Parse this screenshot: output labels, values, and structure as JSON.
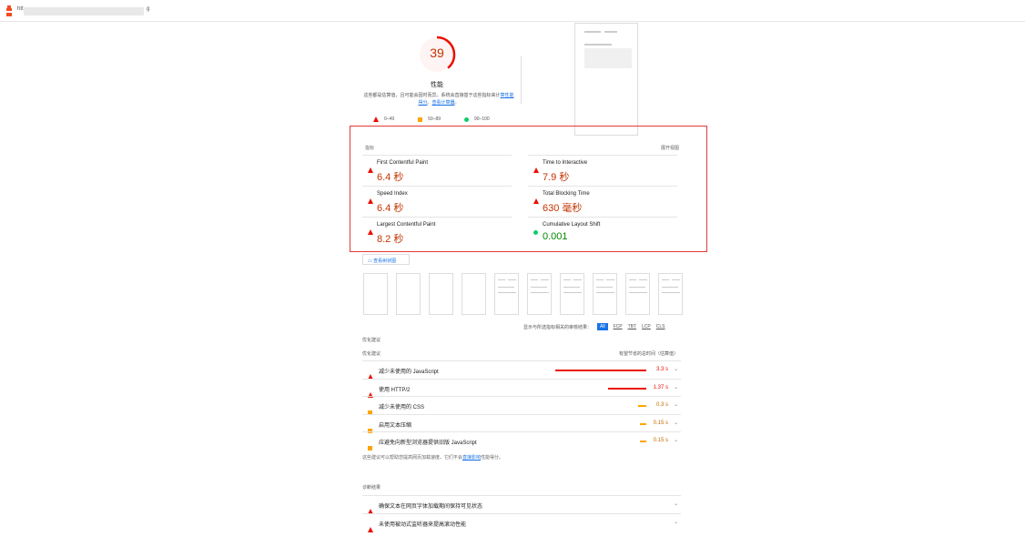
{
  "browser": {
    "url_start": "htt",
    "url_end": "g"
  },
  "score": {
    "value": "39",
    "fraction": 0.39,
    "title": "性能",
    "description": "这些都是估算值，且可能会因时而异。系统会直接基于这些指标来计",
    "link1": "算性能得分",
    "link2": "查看计算器"
  },
  "legend": {
    "fail": "0–49",
    "average": "50–89",
    "pass": "90–100"
  },
  "metrics": {
    "header": "指标",
    "expand": "展开视图",
    "items": [
      {
        "label": "First Contentful Paint",
        "value": "6.4 秒",
        "status": "fail"
      },
      {
        "label": "Time to Interactive",
        "value": "7.9 秒",
        "status": "fail"
      },
      {
        "label": "Speed Index",
        "value": "6.4 秒",
        "status": "fail"
      },
      {
        "label": "Total Blocking Time",
        "value": "630 毫秒",
        "status": "fail"
      },
      {
        "label": "Largest Contentful Paint",
        "value": "8.2 秒",
        "status": "fail"
      },
      {
        "label": "Cumulative Layout Shift",
        "value": "0.001",
        "status": "pass"
      }
    ]
  },
  "treemap": {
    "label": "查看树状图"
  },
  "filter": {
    "label": "显示与所选指标相关的审核结果：",
    "options": [
      "All",
      "FCP",
      "TBT",
      "LCP",
      "CLS"
    ]
  },
  "opportunities": {
    "section_title": "优化建议",
    "col_left": "优化建议",
    "col_right": "有望节省的总时间（估算值）",
    "items": [
      {
        "label": "减少未使用的 JavaScript",
        "savings": "3.3 s",
        "fraction": 1.0,
        "status": "fail"
      },
      {
        "label": "使用 HTTP/2",
        "savings": "1.37 s",
        "fraction": 0.42,
        "status": "fail"
      },
      {
        "label": "减少未使用的 CSS",
        "savings": "0.3 s",
        "fraction": 0.09,
        "status": "average"
      },
      {
        "label": "启用文本压缩",
        "savings": "0.15 s",
        "fraction": 0.045,
        "status": "average"
      },
      {
        "label": "应避免向新型浏览器提供旧版 JavaScript",
        "savings": "0.15 s",
        "fraction": 0.045,
        "status": "average"
      }
    ],
    "note_start": "这些建议可以帮助您提高网页加载速度。它们不会",
    "note_link": "直接影响",
    "note_end": "性能得分。"
  },
  "diagnostics": {
    "section_title": "诊断结果",
    "items": [
      {
        "label": "确保文本在网页字体加载期间保持可见状态",
        "status": "fail"
      },
      {
        "label": "未使用被动式监听器来提高滚动性能",
        "status": "fail"
      }
    ]
  },
  "colors": {
    "fail": "#eb0f00",
    "average": "#ffa400",
    "pass": "#0cce6b",
    "accent": "#1a73e8"
  }
}
